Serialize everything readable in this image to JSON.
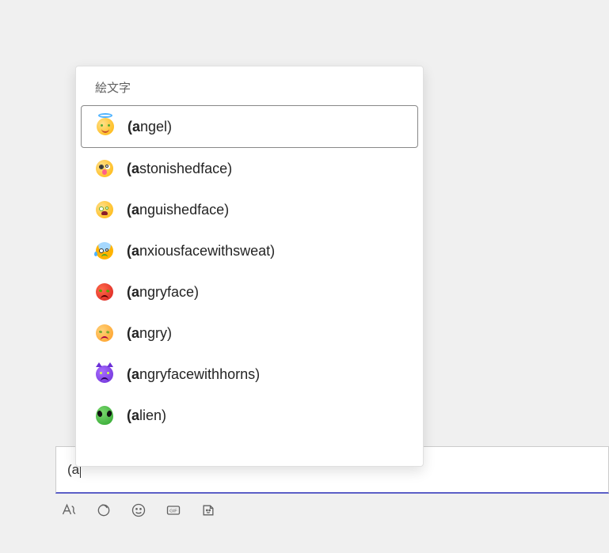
{
  "picker": {
    "title": "絵文字",
    "items": [
      {
        "prefix": "(a",
        "rest": "ngel)",
        "icon": "angel",
        "selected": true
      },
      {
        "prefix": "(a",
        "rest": "stonishedface)",
        "icon": "astonished",
        "selected": false
      },
      {
        "prefix": "(a",
        "rest": "nguishedface)",
        "icon": "anguished",
        "selected": false
      },
      {
        "prefix": "(a",
        "rest": "nxiousfacewithsweat)",
        "icon": "anxious",
        "selected": false
      },
      {
        "prefix": "(a",
        "rest": "ngryface)",
        "icon": "angryface",
        "selected": false
      },
      {
        "prefix": "(a",
        "rest": "ngry)",
        "icon": "angry",
        "selected": false
      },
      {
        "prefix": "(a",
        "rest": "ngryfacewithhorns)",
        "icon": "horns",
        "selected": false
      },
      {
        "prefix": "(a",
        "rest": "lien)",
        "icon": "alien",
        "selected": false
      }
    ]
  },
  "input": {
    "value": "(a"
  },
  "toolbar": {
    "format": "format",
    "loop": "loop",
    "emoji": "emoji",
    "gif": "GIF",
    "sticker": "sticker"
  }
}
